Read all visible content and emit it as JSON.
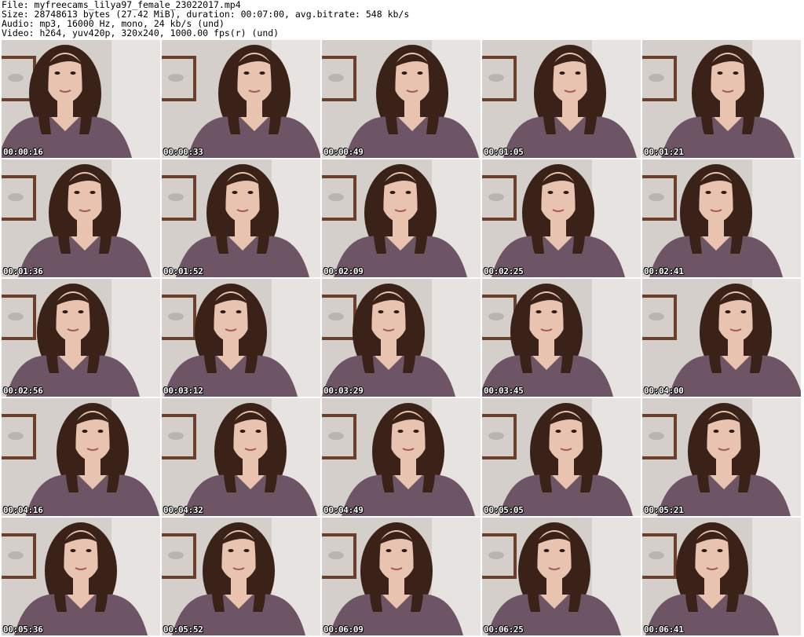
{
  "header": {
    "line1": "File: myfreecams_lilya97_female_23022017.mp4",
    "line2": "Size: 28748613 bytes (27.42 MiB), duration: 00:07:00, avg.bitrate: 548 kb/s",
    "line3": "Audio: mp3, 16000 Hz, mono, 24 kb/s (und)",
    "line4": "Video: h264, yuv420p, 320x240, 1000.00 fps(r) (und)"
  },
  "thumbnails": [
    {
      "timestamp": "00:00:16"
    },
    {
      "timestamp": "00:00:33"
    },
    {
      "timestamp": "00:00:49"
    },
    {
      "timestamp": "00:01:05"
    },
    {
      "timestamp": "00:01:21"
    },
    {
      "timestamp": "00:01:36"
    },
    {
      "timestamp": "00:01:52"
    },
    {
      "timestamp": "00:02:09"
    },
    {
      "timestamp": "00:02:25"
    },
    {
      "timestamp": "00:02:41"
    },
    {
      "timestamp": "00:02:56"
    },
    {
      "timestamp": "00:03:12"
    },
    {
      "timestamp": "00:03:29"
    },
    {
      "timestamp": "00:03:45"
    },
    {
      "timestamp": "00:04:00"
    },
    {
      "timestamp": "00:04:16"
    },
    {
      "timestamp": "00:04:32"
    },
    {
      "timestamp": "00:04:49"
    },
    {
      "timestamp": "00:05:05"
    },
    {
      "timestamp": "00:05:21"
    },
    {
      "timestamp": "00:05:36"
    },
    {
      "timestamp": "00:05:52"
    },
    {
      "timestamp": "00:06:09"
    },
    {
      "timestamp": "00:06:25"
    },
    {
      "timestamp": "00:06:41"
    }
  ],
  "colors": {
    "wall": "#d4cfcb",
    "frame": "#6b3f2a",
    "shirt": "#6e5566",
    "hair": "#3a2218",
    "skin": "#e7c3b0"
  }
}
